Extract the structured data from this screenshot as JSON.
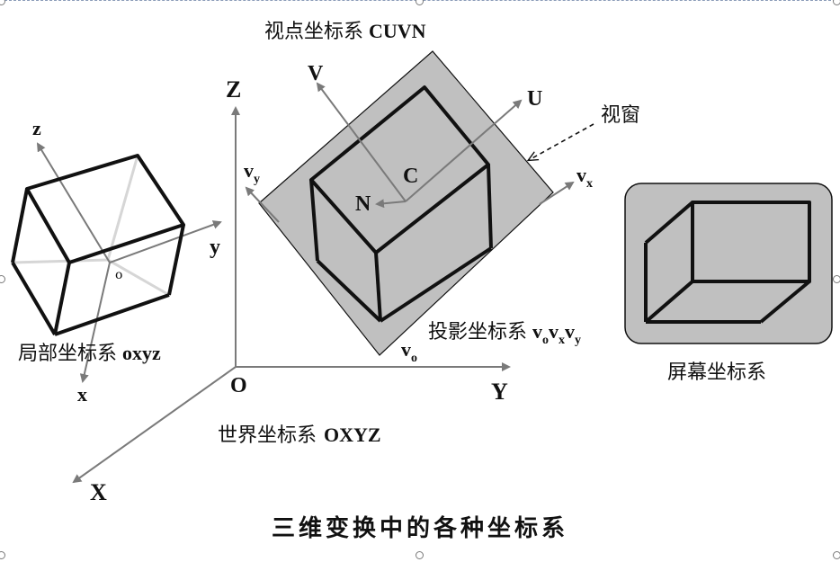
{
  "title": "三维变换中的各种坐标系",
  "world": {
    "caption_cn": "世界坐标系",
    "caption_en": "OXYZ",
    "axis_z": "Z",
    "axis_y": "Y",
    "axis_x": "X",
    "origin": "O"
  },
  "local": {
    "caption_cn": "局部坐标系",
    "caption_en": "oxyz",
    "axis_z": "z",
    "axis_y": "y",
    "axis_x": "x",
    "origin": "o"
  },
  "view": {
    "caption_cn": "视点坐标系",
    "caption_en": "CUVN",
    "axis_v": "V",
    "axis_u": "U",
    "axis_n": "N",
    "center": "C"
  },
  "viewport": {
    "label": "视窗"
  },
  "projection": {
    "caption_cn": "投影坐标系",
    "v": "v",
    "sub_o": "o",
    "sub_x": "x",
    "sub_y": "y"
  },
  "screen": {
    "caption_cn": "屏幕坐标系"
  },
  "colors": {
    "axis": "#7a7a7a",
    "plane_fill": "#c0c0c0",
    "box_edge": "#111111",
    "hidden_edge": "#d6d6d6"
  }
}
